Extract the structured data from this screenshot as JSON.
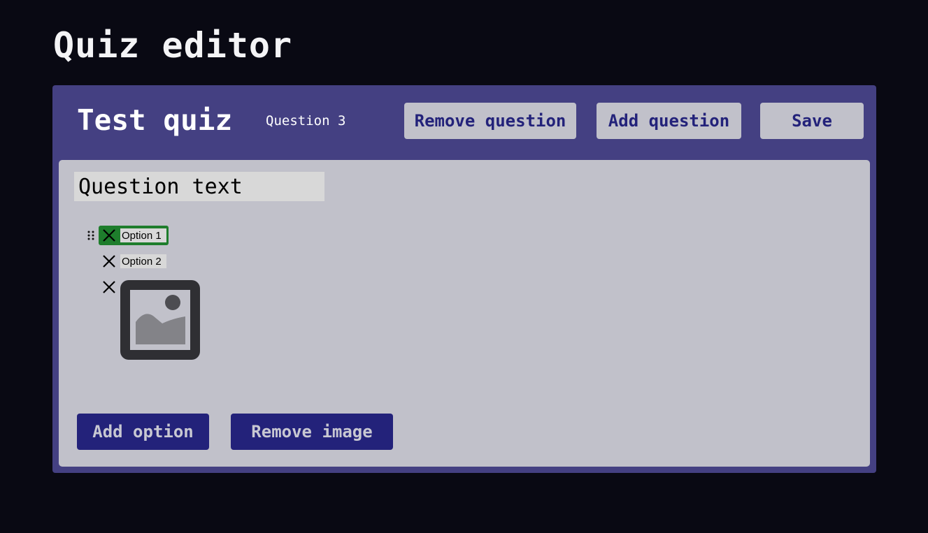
{
  "app": {
    "title": "Quiz editor"
  },
  "header": {
    "quiz_title": "Test quiz",
    "question_indicator": "Question 3",
    "remove_question_label": "Remove question",
    "add_question_label": "Add question",
    "save_label": "Save"
  },
  "question": {
    "text_value": "Question text",
    "options": [
      {
        "label": "Option 1",
        "correct": true
      },
      {
        "label": "Option 2",
        "correct": false
      }
    ],
    "image_option_icon": "image-placeholder-icon"
  },
  "actions": {
    "add_option_label": "Add option",
    "remove_image_label": "Remove image"
  },
  "colors": {
    "background": "#090913",
    "panel": "#444082",
    "editor": "#c1c1ca",
    "accent_dark": "#23227a",
    "correct_option": "#1e7d2c"
  }
}
